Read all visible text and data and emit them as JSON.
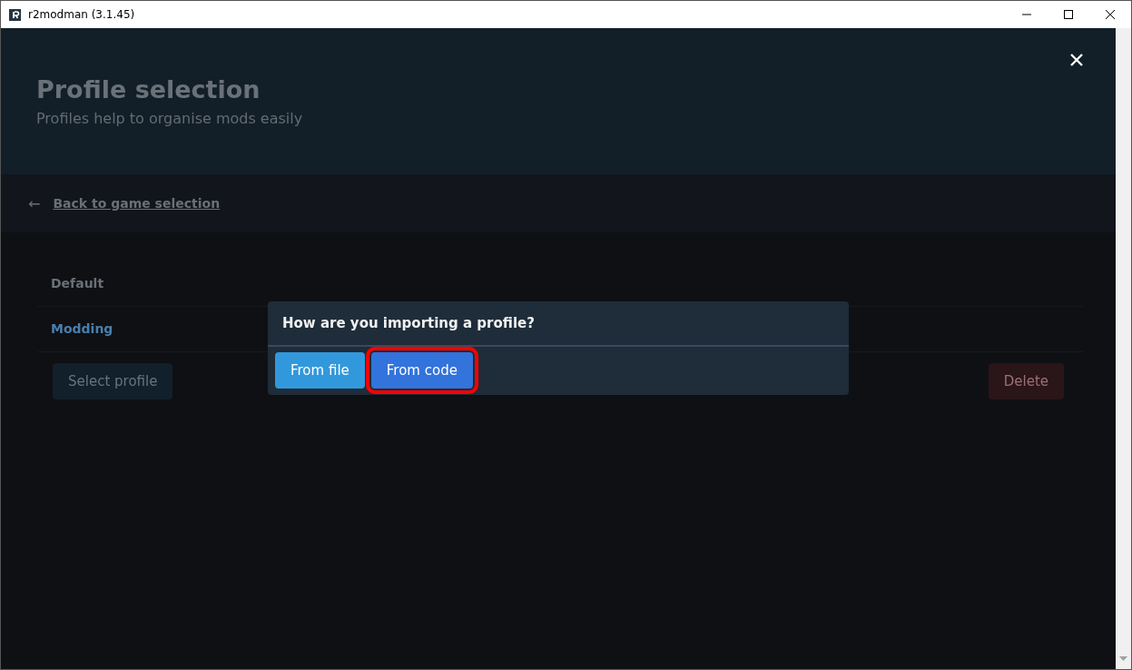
{
  "window": {
    "title": "r2modman (3.1.45)"
  },
  "hero": {
    "title": "Profile selection",
    "subtitle": "Profiles help to organise mods easily"
  },
  "back_link": {
    "arrow": "←",
    "label": "Back to game selection"
  },
  "profiles": [
    {
      "name": "Default",
      "selected": false
    },
    {
      "name": "Modding",
      "selected": true
    }
  ],
  "actions": [
    {
      "label": "Select profile",
      "kind": "primary"
    },
    {
      "label": "Delete",
      "kind": "danger"
    }
  ],
  "modal": {
    "title": "How are you importing a profile?",
    "buttons": [
      {
        "label": "From file",
        "kind": "info",
        "highlighted": false
      },
      {
        "label": "From code",
        "kind": "link",
        "highlighted": true
      }
    ]
  }
}
